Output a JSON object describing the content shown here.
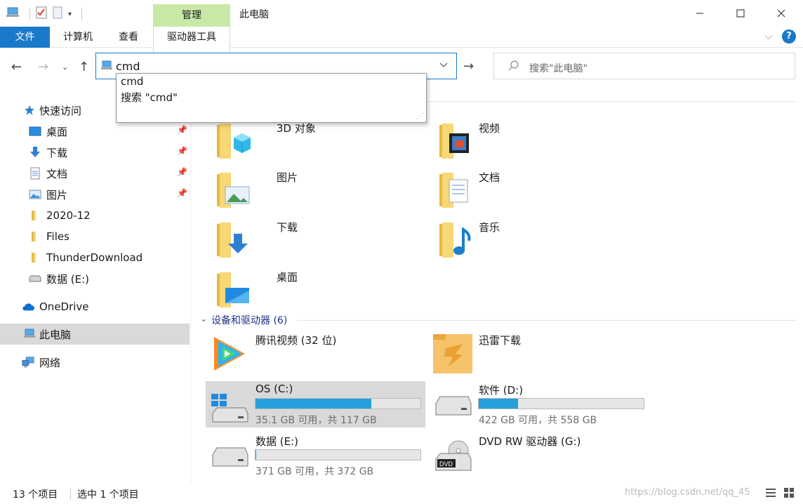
{
  "titlebar": {
    "manage_tab": "管理",
    "window_title": "此电脑"
  },
  "ribbon": {
    "file": "文件",
    "computer": "计算机",
    "view": "查看",
    "drive_tools": "驱动器工具"
  },
  "navbar": {
    "address_value": "cmd",
    "search_placeholder": "搜索\"此电脑\""
  },
  "dropdown": {
    "items": [
      "cmd",
      "搜索 \"cmd\""
    ]
  },
  "sidebar": {
    "quick_access": "快速访问",
    "items": [
      {
        "label": "桌面",
        "icon": "desktop-icon",
        "pinned": true
      },
      {
        "label": "下载",
        "icon": "download-icon",
        "pinned": true
      },
      {
        "label": "文档",
        "icon": "document-icon",
        "pinned": true
      },
      {
        "label": "图片",
        "icon": "picture-icon",
        "pinned": true
      },
      {
        "label": "2020-12",
        "icon": "folder-icon",
        "pinned": false
      },
      {
        "label": "Files",
        "icon": "folder-icon",
        "pinned": false
      },
      {
        "label": "ThunderDownload",
        "icon": "folder-icon",
        "pinned": false
      },
      {
        "label": "数据 (E:)",
        "icon": "drive-icon",
        "pinned": false
      }
    ],
    "onedrive": "OneDrive",
    "this_pc": "此电脑",
    "network": "网络"
  },
  "folders": [
    {
      "label": "3D 对象",
      "icon": "3d-objects-icon"
    },
    {
      "label": "视频",
      "icon": "video-icon"
    },
    {
      "label": "图片",
      "icon": "picture-icon"
    },
    {
      "label": "文档",
      "icon": "document-icon"
    },
    {
      "label": "下载",
      "icon": "download-icon"
    },
    {
      "label": "音乐",
      "icon": "music-icon"
    },
    {
      "label": "桌面",
      "icon": "desktop-icon"
    }
  ],
  "devices": {
    "header": "设备和驱动器 (6)",
    "items": [
      {
        "name": "腾讯视频 (32 位)",
        "icon": "tencent-video-icon"
      },
      {
        "name": "迅雷下载",
        "icon": "thunder-icon"
      },
      {
        "name": "OS (C:)",
        "info": "35.1 GB 可用，共 117 GB",
        "used_fraction": 0.7,
        "icon": "windows-drive-icon"
      },
      {
        "name": "软件 (D:)",
        "info": "422 GB 可用，共 558 GB",
        "used_fraction": 0.24,
        "icon": "drive-icon"
      },
      {
        "name": "数据 (E:)",
        "info": "371 GB 可用，共 372 GB",
        "used_fraction": 0.003,
        "icon": "drive-icon"
      },
      {
        "name": "DVD RW 驱动器 (G:)",
        "icon": "dvd-icon"
      }
    ]
  },
  "statusbar": {
    "item_count": "13 个项目",
    "selected": "选中 1 个项目",
    "watermark": "https://blog.csdn.net/qq_45"
  },
  "colors": {
    "accent": "#1979ca",
    "manage_tab": "#c8e9a6",
    "drive_bar": "#26a0da",
    "selected": "#d9d9d9"
  }
}
